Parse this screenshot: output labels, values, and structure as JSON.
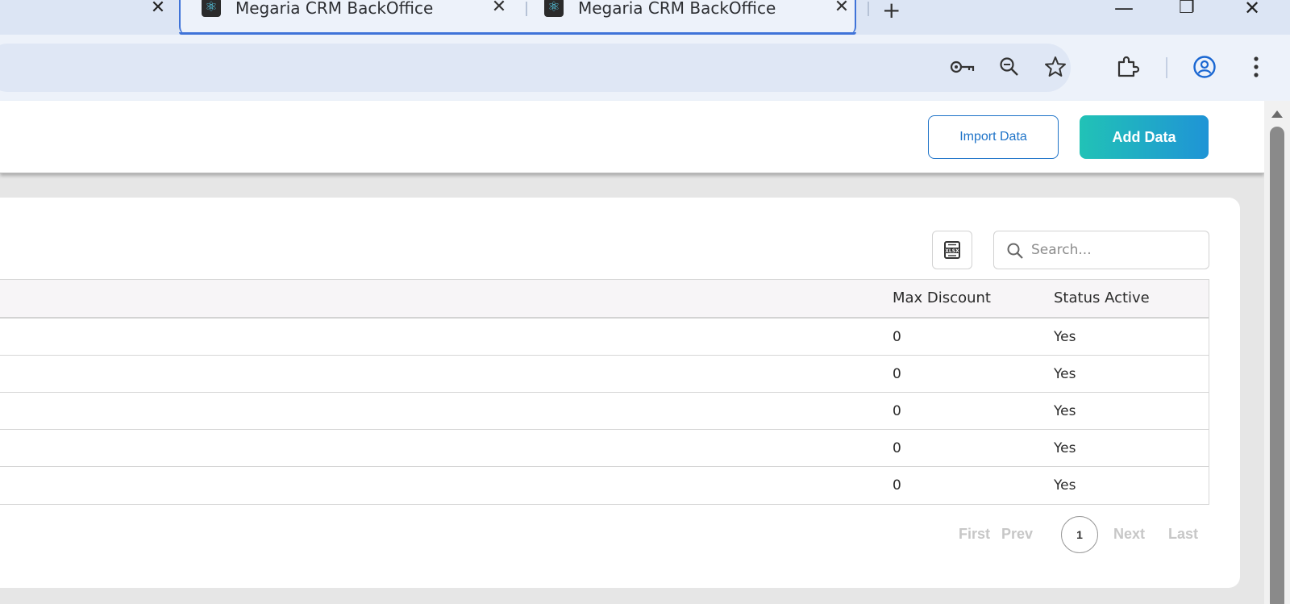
{
  "browser": {
    "tabs": [
      {
        "title": "Megaria CRM BackOffice",
        "active": true
      },
      {
        "title": "Megaria CRM BackOffice",
        "active": false
      }
    ],
    "new_tab_label": "+",
    "close_glyph": "✕",
    "window_controls": {
      "minimize": "—",
      "restore": "❐",
      "close": "✕"
    }
  },
  "toolbar_icons": [
    "password-key-icon",
    "zoom-icon",
    "bookmark-star-icon",
    "extensions-icon",
    "profile-icon",
    "menu-icon"
  ],
  "header": {
    "import_label": "Import Data",
    "add_label": "Add Data"
  },
  "search": {
    "placeholder": "Search...",
    "value": ""
  },
  "table": {
    "columns": [
      "Max Discount",
      "Status Active"
    ],
    "rows": [
      {
        "max_discount": "0",
        "status_active": "Yes"
      },
      {
        "max_discount": "0",
        "status_active": "Yes"
      },
      {
        "max_discount": "0",
        "status_active": "Yes"
      },
      {
        "max_discount": "0",
        "status_active": "Yes"
      },
      {
        "max_discount": "0",
        "status_active": "Yes"
      }
    ]
  },
  "pagination": {
    "first": "First",
    "prev": "Prev",
    "current": "1",
    "next": "Next",
    "last": "Last"
  },
  "colors": {
    "accent_blue": "#1e73c8",
    "gradient_start": "#21c2b6",
    "gradient_end": "#1f94d6",
    "tab_highlight": "#3f73d8"
  }
}
